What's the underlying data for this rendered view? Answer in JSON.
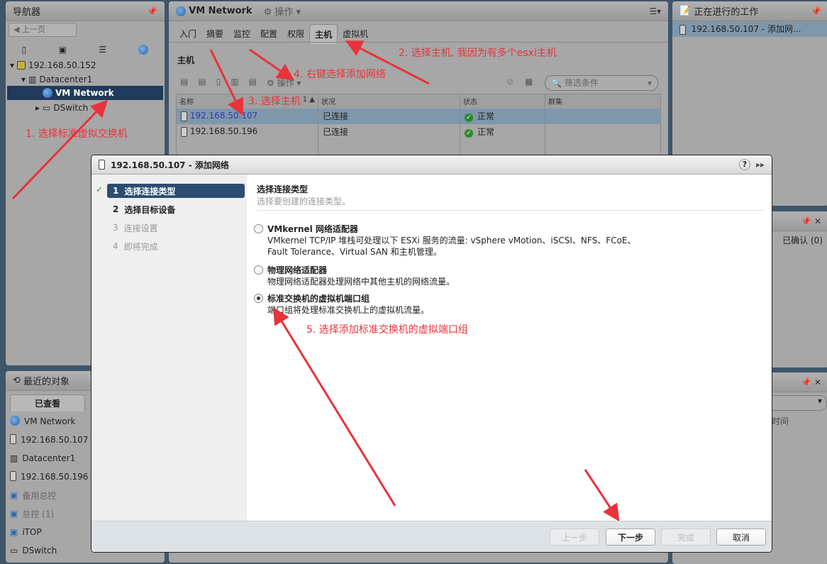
{
  "navigator": {
    "title": "导航器",
    "back": "上一页",
    "tree": [
      {
        "label": "192.168.50.152",
        "icon": "vcenter-icon"
      },
      {
        "label": "Datacenter1",
        "icon": "datacenter-icon"
      },
      {
        "label": "VM Network",
        "icon": "network-icon",
        "selected": true
      },
      {
        "label": "DSwitch",
        "icon": "switch-icon"
      }
    ]
  },
  "recent": {
    "title": "最近的对象",
    "tab": "已查看",
    "items": [
      {
        "label": "VM Network",
        "icon": "network-icon"
      },
      {
        "label": "192.168.50.107",
        "icon": "host-icon"
      },
      {
        "label": "Datacenter1",
        "icon": "datacenter-icon"
      },
      {
        "label": "192.168.50.196",
        "icon": "host-icon"
      },
      {
        "label": "备用总控",
        "icon": "vapp-icon"
      },
      {
        "label": "总控 (1)",
        "icon": "vapp-icon"
      },
      {
        "label": "iTOP",
        "icon": "vapp-icon"
      },
      {
        "label": "DSwitch",
        "icon": "switch-icon"
      }
    ]
  },
  "main": {
    "title": "VM Network",
    "actions": "操作",
    "tabs": [
      "入门",
      "摘要",
      "监控",
      "配置",
      "权限",
      "主机",
      "虚拟机"
    ],
    "active_tab": "主机",
    "section": "主机",
    "toolbar_actions": "操作",
    "filter_placeholder": "筛选条件",
    "columns": [
      "名称",
      "状况",
      "状态",
      "群集"
    ],
    "sort_indicator": "1 ▲",
    "rows": [
      {
        "name": "192.168.50.107",
        "condition": "已连接",
        "status": "正常",
        "cluster": "",
        "selected": true
      },
      {
        "name": "192.168.50.196",
        "condition": "已连接",
        "status": "正常",
        "cluster": ""
      }
    ]
  },
  "work": {
    "title": "正在进行的工作",
    "item": "192.168.50.107 - 添加网..."
  },
  "alarms": {
    "confirmed": "已确认 (0)"
  },
  "tasks": {
    "col": "时间"
  },
  "dialog": {
    "title": "192.168.50.107 - 添加网络",
    "steps": [
      {
        "n": "1",
        "label": "选择连接类型",
        "state": "active"
      },
      {
        "n": "2",
        "label": "选择目标设备",
        "state": "normal"
      },
      {
        "n": "3",
        "label": "连接设置",
        "state": "disabled"
      },
      {
        "n": "4",
        "label": "即将完成",
        "state": "disabled"
      }
    ],
    "heading": "选择连接类型",
    "subheading": "选择要创建的连接类型。",
    "options": [
      {
        "title": "VMkernel 网络适配器",
        "desc1": "VMkernel TCP/IP 堆栈可处理以下 ESXi 服务的流量: vSphere vMotion、iSCSI、NFS、FCoE、",
        "desc2": "Fault Tolerance、Virtual SAN 和主机管理。",
        "selected": false
      },
      {
        "title": "物理网络适配器",
        "desc1": "物理网络适配器处理网络中其他主机的网络流量。",
        "selected": false
      },
      {
        "title": "标准交换机的虚拟机端口组",
        "desc1": "端口组将处理标准交换机上的虚拟机流量。",
        "selected": true
      }
    ],
    "buttons": {
      "back": "上一步",
      "next": "下一步",
      "finish": "完成",
      "cancel": "取消"
    }
  },
  "annotations": [
    "1. 选择标准虚拟交换机",
    "2. 选择主机, 我因为有多个esxi主机",
    "3. 选择主机",
    "4. 右键选择添加网络",
    "5. 选择添加标准交换机的虚拟端口组"
  ],
  "colors": {
    "annotation": "#e8333b",
    "selected_nav": "#1f3a5a",
    "step_active": "#2c4c72"
  }
}
